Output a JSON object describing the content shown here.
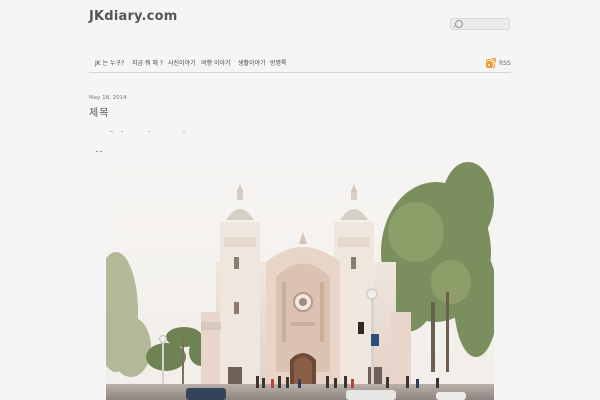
{
  "site": {
    "title": "JKdiary.com"
  },
  "search": {
    "placeholder": ""
  },
  "nav": {
    "items": [
      {
        "label": "JK 는 누구?"
      },
      {
        "label": "지금 뭐 해 ?"
      },
      {
        "label": "사진이야기"
      },
      {
        "label": "여행 이야기"
      },
      {
        "label": "생활이야기"
      },
      {
        "label": "방명록"
      }
    ],
    "rss_label": "RSS"
  },
  "post": {
    "date": "May 18, 2014",
    "title": "제목"
  },
  "colors": {
    "background": "#f5f5f5",
    "title": "#555555",
    "nav_text": "#444444",
    "rss": "#f29a2e"
  },
  "icons": [
    "search-icon",
    "rss-icon"
  ]
}
